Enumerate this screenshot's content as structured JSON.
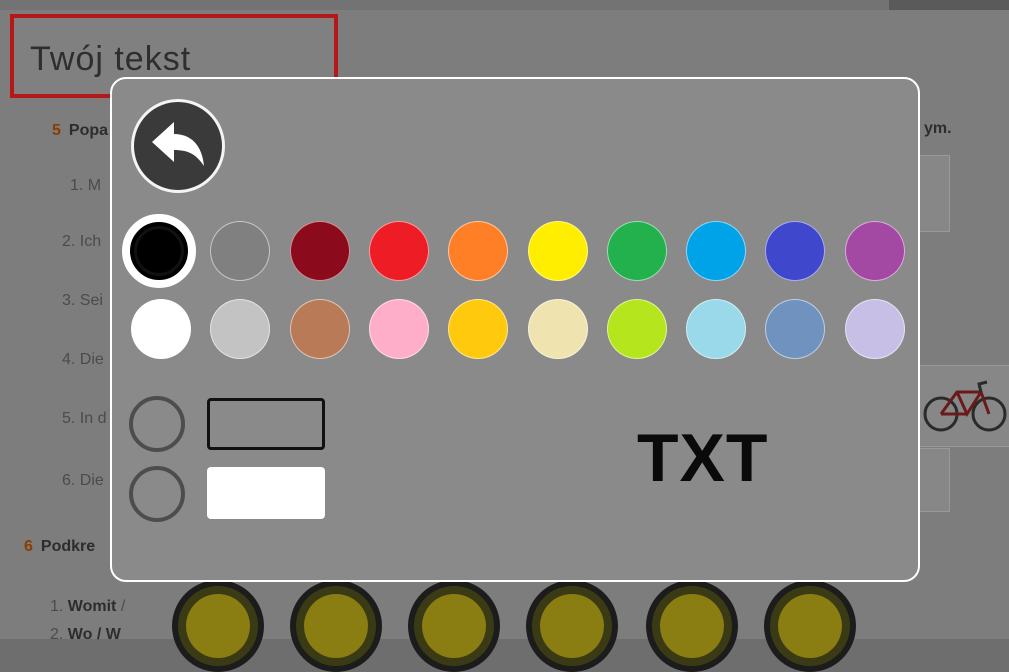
{
  "background": {
    "title": "Twój tekst",
    "exercise5_num": "5",
    "exercise5_heading": "Popa",
    "items": [
      "1. M",
      "2. Ich",
      "3. Sei",
      "4. Die",
      "5. In d",
      "6. Die"
    ],
    "exercise6_num": "6",
    "exercise6_heading": "Podkre",
    "item7_num": "1.",
    "item7_bold": "Womit",
    "item7_rest": " /",
    "item8_num": "2.",
    "item8_bold": "Wo / W",
    "right_text": "ym."
  },
  "dialog": {
    "back_icon": "back-arrow-icon",
    "colors": {
      "row1": [
        "#000000",
        "#808080",
        "#8b0a1c",
        "#ee1c24",
        "#ff7f27",
        "#ffee00",
        "#22b14c",
        "#00a2e8",
        "#3f48cc",
        "#a349a4"
      ],
      "row2": [
        "#ffffff",
        "#c3c3c3",
        "#b97a57",
        "#ffaec9",
        "#ffc90e",
        "#efe4b0",
        "#b5e61d",
        "#99d9ea",
        "#7092be",
        "#c8bfe7"
      ],
      "selected": "#000000"
    },
    "box_styles": [
      "outline",
      "filled"
    ],
    "preview_text": "TXT"
  }
}
